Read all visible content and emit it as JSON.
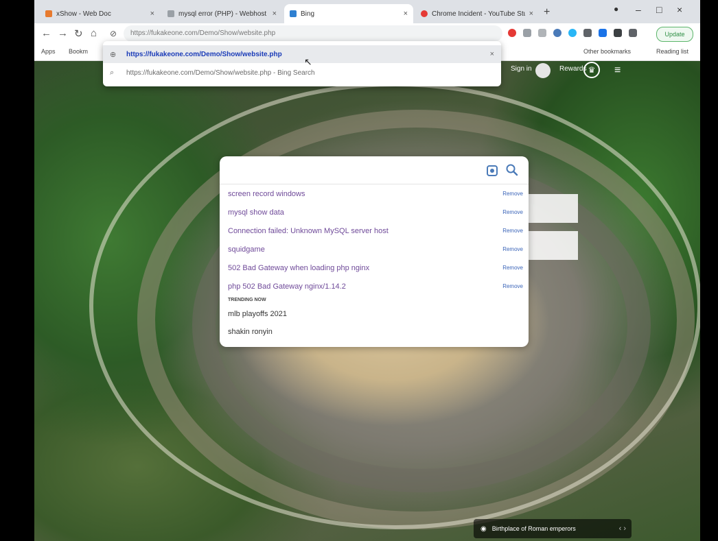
{
  "browser": {
    "tabs": [
      {
        "label": "xShow - Web Doc",
        "color": "#e77a2e",
        "active": false
      },
      {
        "label": "mysql error (PHP) - Webhost Bi",
        "color": "#9aa0a6",
        "active": false
      },
      {
        "label": "Bing",
        "color": "#2f80d1",
        "active": true
      },
      {
        "label": "Chrome Incident - YouTube Stu",
        "color": "#e53935",
        "active": false
      }
    ],
    "new_tab": "+",
    "address": "https://fukakeone.com/Demo/Show/website.php",
    "update_label": "Update"
  },
  "bookmarks": [
    {
      "label": "Apps"
    },
    {
      "label": "Bookm"
    },
    {
      "label": "Other bookmarks"
    },
    {
      "label": "Reading list"
    }
  ],
  "omnibox_dropdown": [
    {
      "text": "https://fukakeone.com/Demo/Show/website.php",
      "kind": "url"
    },
    {
      "text": "https://fukakeone.com/Demo/Show/website.php - Bing Search",
      "kind": "search"
    }
  ],
  "bing_header": {
    "signin": "Sign in",
    "rewards": "Rewards"
  },
  "search": {
    "query": "",
    "suggestions": [
      {
        "text": "screen record windows",
        "remove": "Remove"
      },
      {
        "text": "mysql show data",
        "remove": "Remove"
      },
      {
        "text": "Connection failed: Unknown MySQL server host",
        "remove": "Remove"
      },
      {
        "text": "squidgame",
        "remove": "Remove"
      },
      {
        "text": "502 Bad Gateway when loading php nginx",
        "remove": "Remove"
      },
      {
        "text": "php 502 Bad Gateway nginx/1.14.2",
        "remove": "Remove"
      }
    ],
    "trending_label": "TRENDING NOW",
    "trending": [
      {
        "text": "mlb playoffs 2021"
      },
      {
        "text": "shakin ronyin"
      }
    ]
  },
  "caption": {
    "text": "Birthplace of Roman emperors",
    "arrows": "‹ ›"
  },
  "colors": {
    "accent": "#2f80d1",
    "suggestion_text": "#6f4a99",
    "remove_link": "#3a64b8"
  }
}
